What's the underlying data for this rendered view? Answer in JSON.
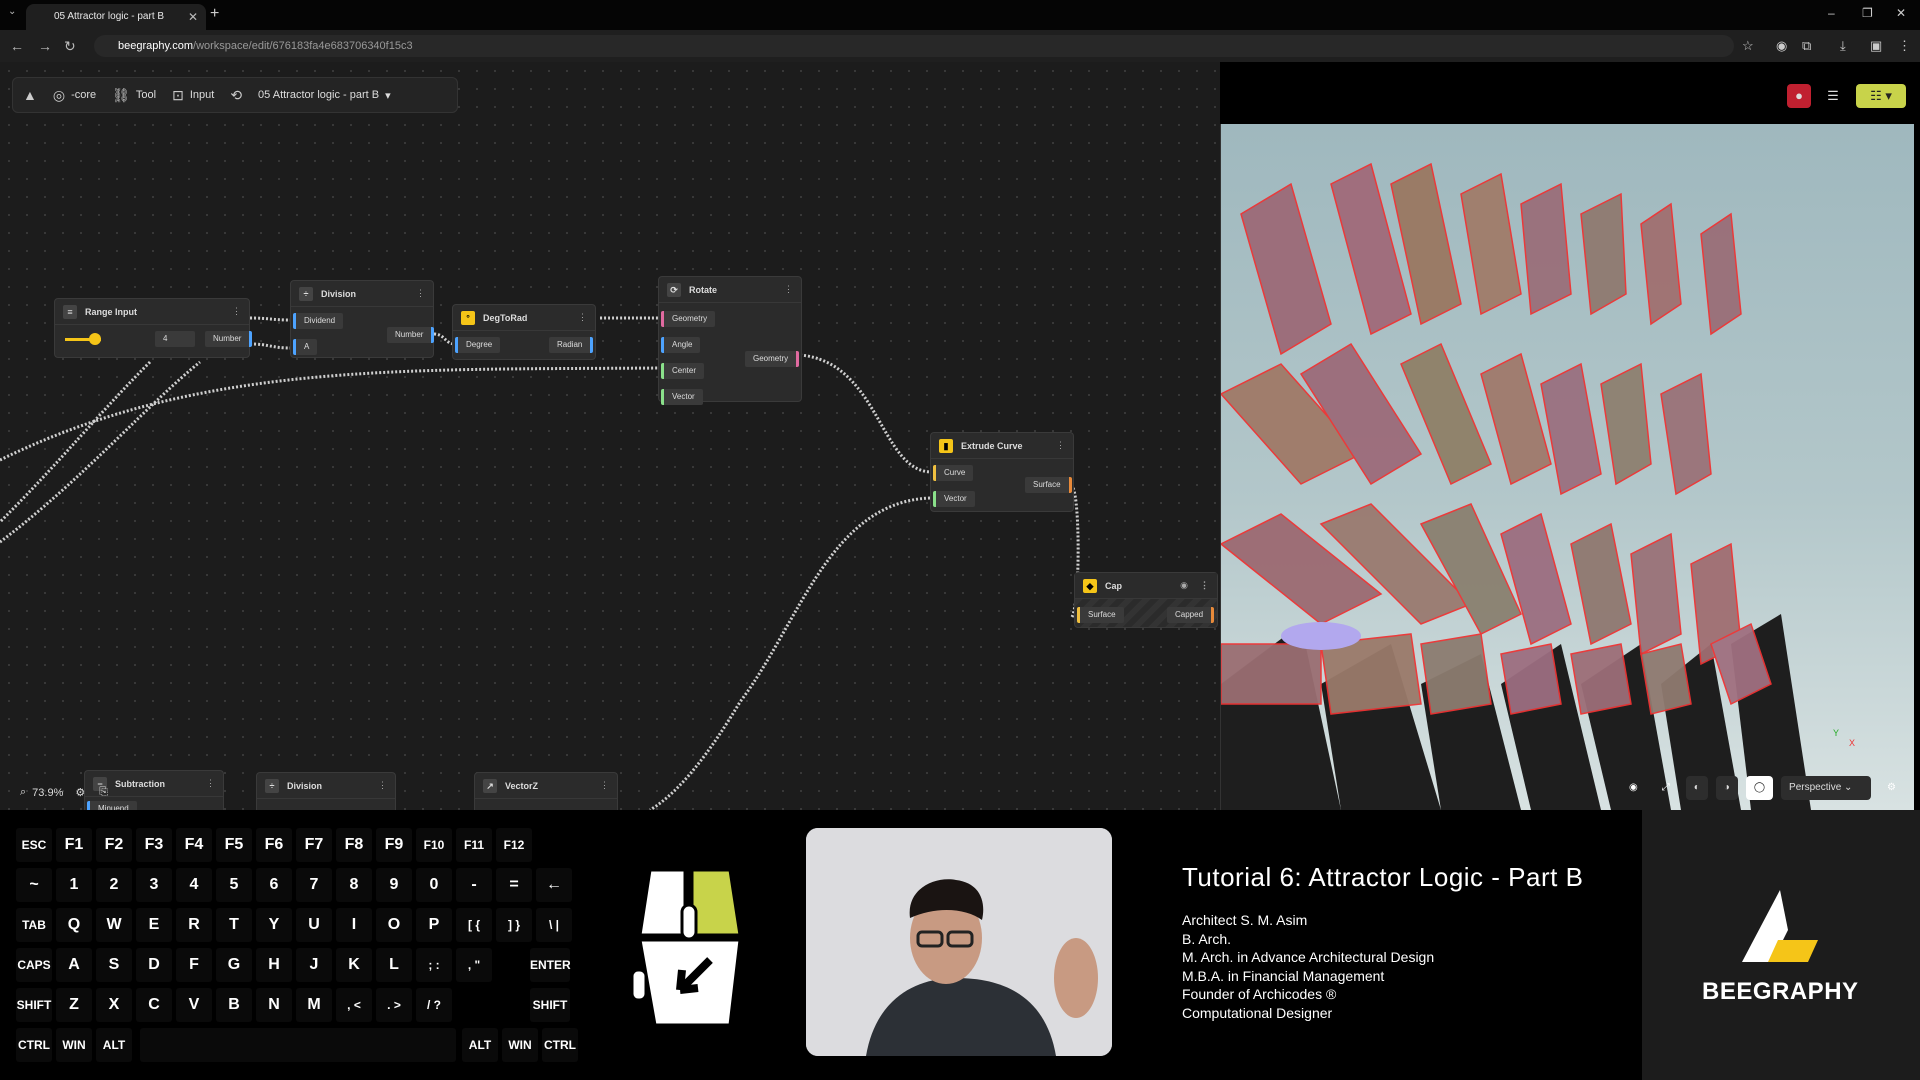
{
  "browser": {
    "tab_title": "05 Attractor logic - part B",
    "tab_close": "✕",
    "new_tab": "+",
    "url_host": "beegraphy.com",
    "url_path": "/workspace/edit/676183fa4e683706340f15c3",
    "window_controls": [
      "–",
      "❐",
      "✕"
    ]
  },
  "toolbar": {
    "core_label": "-core",
    "tool_label": "Tool",
    "input_label": "Input",
    "file_name": "05 Attractor logic - part B"
  },
  "nodes": {
    "range_input": {
      "title": "Range Input",
      "value": "4",
      "out": "Number"
    },
    "division": {
      "title": "Division",
      "in1": "Dividend",
      "in2": "A",
      "out": "Number"
    },
    "degtorad": {
      "title": "DegToRad",
      "in": "Degree",
      "out": "Radian"
    },
    "rotate": {
      "title": "Rotate",
      "in1": "Geometry",
      "in2": "Angle",
      "in3": "Center",
      "in4": "Vector",
      "out": "Geometry"
    },
    "extrude": {
      "title": "Extrude Curve",
      "in1": "Curve",
      "in2": "Vector",
      "out": "Surface"
    },
    "cap": {
      "title": "Cap",
      "in": "Surface",
      "out": "Capped"
    },
    "subtraction": {
      "title": "Subtraction",
      "in": "Minuend"
    },
    "division2": {
      "title": "Division"
    },
    "vectorz": {
      "title": "VectorZ"
    }
  },
  "zoom": "73.9%",
  "viewport": {
    "mode": "Perspective",
    "axes": {
      "y": "Y",
      "x": "X"
    }
  },
  "keyboard": {
    "row1": [
      "ESC",
      "F1",
      "F2",
      "F3",
      "F4",
      "F5",
      "F6",
      "F7",
      "F8",
      "F9",
      "F10",
      "F11",
      "F12"
    ],
    "row2": [
      "~",
      "1",
      "2",
      "3",
      "4",
      "5",
      "6",
      "7",
      "8",
      "9",
      "0",
      "-",
      "=",
      "←"
    ],
    "row3": [
      "TAB",
      "Q",
      "W",
      "E",
      "R",
      "T",
      "Y",
      "U",
      "I",
      "O",
      "P",
      "[ {",
      "] }",
      "\\ |"
    ],
    "row4": [
      "CAPS",
      "A",
      "S",
      "D",
      "F",
      "G",
      "H",
      "J",
      "K",
      "L",
      "; :",
      ", \"",
      "ENTER"
    ],
    "row5": [
      "SHIFT",
      "Z",
      "X",
      "C",
      "V",
      "B",
      "N",
      "M",
      ", <",
      ". >",
      "/ ?",
      "SHIFT"
    ],
    "row6": [
      "CTRL",
      "WIN",
      "ALT",
      "ALT",
      "WIN",
      "CTRL"
    ]
  },
  "credits": {
    "title": "Tutorial 6: Attractor Logic - Part B",
    "lines": [
      "Architect S. M. Asim",
      "B. Arch.",
      "M. Arch. in Advance Architectural Design",
      "M.B.A. in Financial Management",
      "Founder of Archicodes ®",
      "Computational Designer"
    ]
  },
  "brand": {
    "name": "BEEGRAPHY"
  },
  "colors": {
    "accent_yellow": "#c8d34a",
    "brand_yellow": "#f5c518",
    "wire": "#cfcfcf"
  }
}
